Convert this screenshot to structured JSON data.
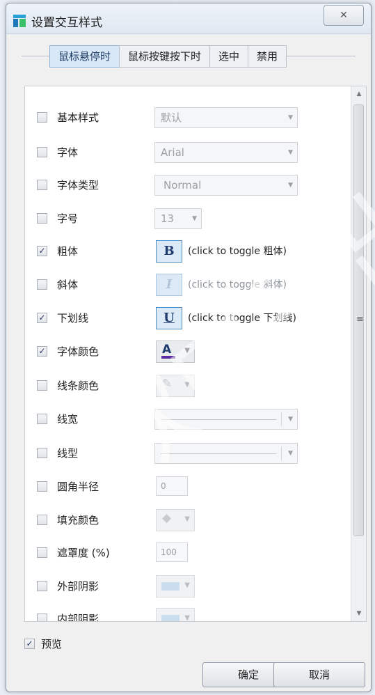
{
  "window": {
    "title": "设置交互样式",
    "close_glyph": "✕"
  },
  "tabs": [
    {
      "label": "鼠标悬停时",
      "active": true
    },
    {
      "label": "鼠标按键按下时",
      "active": false
    },
    {
      "label": "选中",
      "active": false
    },
    {
      "label": "禁用",
      "active": false
    }
  ],
  "rows": {
    "base_style": {
      "label": "基本样式",
      "checked": false,
      "value": "默认"
    },
    "font": {
      "label": "字体",
      "checked": false,
      "value": "Arial"
    },
    "font_type": {
      "label": "字体类型",
      "checked": false,
      "value": "Normal"
    },
    "font_size": {
      "label": "字号",
      "checked": false,
      "value": "13"
    },
    "bold": {
      "label": "粗体",
      "checked": true,
      "button": "B",
      "note": "(click to toggle 粗体)"
    },
    "italic": {
      "label": "斜体",
      "checked": false,
      "button": "I",
      "note": "(click to toggle 斜体)"
    },
    "underline": {
      "label": "下划线",
      "checked": true,
      "button": "U",
      "note": "(click to toggle 下划线)"
    },
    "font_color": {
      "label": "字体颜色",
      "checked": true,
      "glyph": "A",
      "swatch_color": "#5a2ca0"
    },
    "line_color": {
      "label": "线条颜色",
      "checked": false,
      "glyph": "✎"
    },
    "line_width": {
      "label": "线宽",
      "checked": false
    },
    "line_style": {
      "label": "线型",
      "checked": false
    },
    "corner_radius": {
      "label": "圆角半径",
      "checked": false,
      "value": "0"
    },
    "fill_color": {
      "label": "填充颜色",
      "checked": false,
      "glyph": "◆"
    },
    "opacity": {
      "label": "遮罩度 (%)",
      "checked": false,
      "value": "100"
    },
    "outer_shadow": {
      "label": "外部阴影",
      "checked": false
    },
    "inner_shadow": {
      "label": "内部阴影",
      "checked": false
    }
  },
  "preview": {
    "label": "预览",
    "checked": true
  },
  "buttons": {
    "ok": "确定",
    "cancel": "取消"
  },
  "check_glyph": "✓",
  "watermark": "软电子出版社"
}
